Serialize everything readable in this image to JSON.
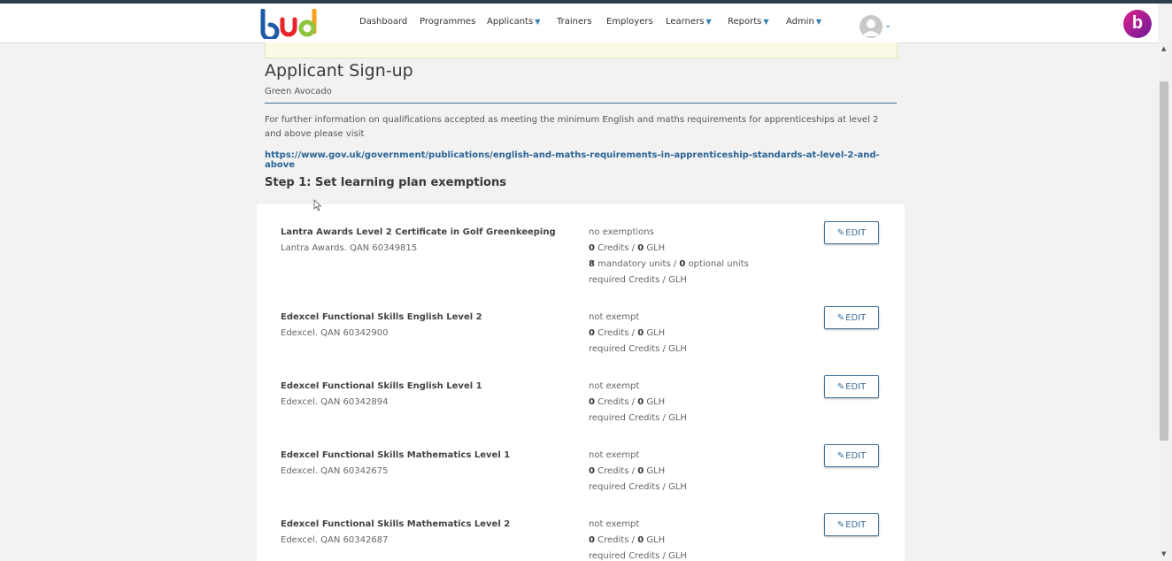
{
  "nav": {
    "items": [
      {
        "label": "Dashboard",
        "dropdown": false
      },
      {
        "label": "Programmes",
        "dropdown": false
      },
      {
        "label": "Applicants",
        "dropdown": true
      },
      {
        "label": "Trainers",
        "dropdown": false
      },
      {
        "label": "Employers",
        "dropdown": false
      },
      {
        "label": "Learners",
        "dropdown": true
      },
      {
        "label": "Reports",
        "dropdown": true
      },
      {
        "label": "Admin",
        "dropdown": true
      }
    ],
    "brand_letter": "b",
    "logo_text": "bud"
  },
  "page": {
    "title": "Applicant Sign-up",
    "subtitle": "Green Avocado",
    "info": "For further information on qualifications accepted as meeting the minimum English and maths requirements for apprenticeships at level 2 and above please visit",
    "link": "https://www.gov.uk/government/publications/english-and-maths-requirements-in-apprenticeship-standards-at-level-2-and-above",
    "step_title": "Step 1: Set learning plan exemptions"
  },
  "qualifications": [
    {
      "name": "Lantra Awards Level 2 Certificate in Golf Greenkeeping",
      "meta": "Lantra Awards. QAN 60349815",
      "status": "no exemptions",
      "credits": "0",
      "glh": "0",
      "mandatory_units": "8",
      "optional_units": "0",
      "required": "required Credits / GLH",
      "edit_label": "EDIT"
    },
    {
      "name": "Edexcel Functional Skills English Level 2",
      "meta": "Edexcel. QAN 60342900",
      "status": "not exempt",
      "credits": "0",
      "glh": "0",
      "required": "required Credits / GLH",
      "edit_label": "EDIT"
    },
    {
      "name": "Edexcel Functional Skills English Level 1",
      "meta": "Edexcel. QAN 60342894",
      "status": "not exempt",
      "credits": "0",
      "glh": "0",
      "required": "required Credits / GLH",
      "edit_label": "EDIT"
    },
    {
      "name": "Edexcel Functional Skills Mathematics Level 1",
      "meta": "Edexcel. QAN 60342675",
      "status": "not exempt",
      "credits": "0",
      "glh": "0",
      "required": "required Credits / GLH",
      "edit_label": "EDIT"
    },
    {
      "name": "Edexcel Functional Skills Mathematics Level 2",
      "meta": "Edexcel. QAN 60342687",
      "status": "not exempt",
      "credits": "0",
      "glh": "0",
      "required": "required Credits / GLH",
      "edit_label": "EDIT"
    }
  ],
  "labels": {
    "credits": "Credits",
    "glh": "GLH",
    "mandatory": "mandatory units",
    "optional": "optional units"
  },
  "colors": {
    "accent": "#3c6e99",
    "link": "#2a6496",
    "brand": "#e0218a"
  }
}
